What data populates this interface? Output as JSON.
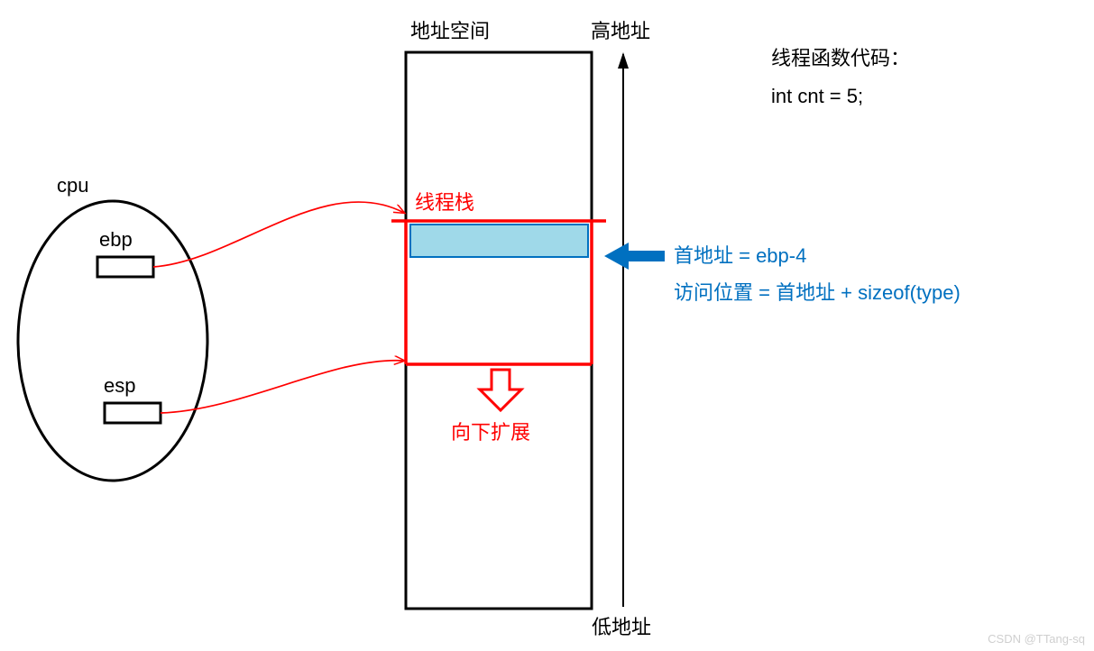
{
  "title_address_space": "地址空间",
  "high_address": "高地址",
  "low_address": "低地址",
  "cpu_label": "cpu",
  "ebp_label": "ebp",
  "esp_label": "esp",
  "thread_stack": "线程栈",
  "expand_down": "向下扩展",
  "code_title": "线程函数代码：",
  "code_line1": "int cnt = 5;",
  "formula_line1": "首地址 = ebp-4",
  "formula_line2": "访问位置 = 首地址 + sizeof(type)",
  "watermark": "CSDN @TTang-sq"
}
